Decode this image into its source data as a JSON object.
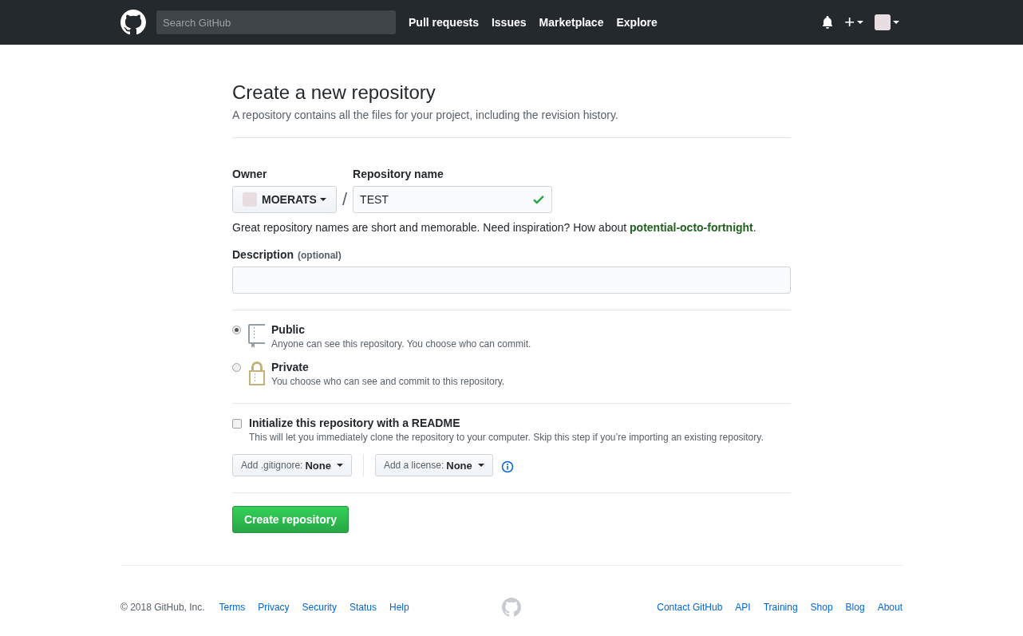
{
  "header": {
    "search": {
      "placeholder": "Search GitHub"
    },
    "nav": [
      "Pull requests",
      "Issues",
      "Marketplace",
      "Explore"
    ],
    "new_menu": "+"
  },
  "page": {
    "title": "Create a new repository",
    "subtitle": "A repository contains all the files for your project, including the revision history."
  },
  "owner": {
    "label": "Owner",
    "value": "MOERATS"
  },
  "separator": "/",
  "repository_name": {
    "label": "Repository name",
    "value": "TEST",
    "valid": true
  },
  "name_hint": {
    "text": "Great repository names are short and memorable. Need inspiration? How about ",
    "suggestion": "potential-octo-fortnight",
    "end": "."
  },
  "description": {
    "label": "Description",
    "note": "(optional)"
  },
  "visibility": [
    {
      "kind": "public",
      "title": "Public",
      "description": "Anyone can see this repository. You choose who can commit.",
      "selected": true
    },
    {
      "kind": "private",
      "title": "Private",
      "description": "You choose who can see and commit to this repository.",
      "selected": false
    }
  ],
  "readme": {
    "label": "Initialize this repository with a README",
    "description": "This will let you immediately clone the repository to your computer. Skip this step if you’re importing an existing repository.",
    "checked": false
  },
  "gitignore": {
    "label": "Add .gitignore:",
    "value": "None"
  },
  "license": {
    "label": "Add a license:",
    "value": "None"
  },
  "submit": "Create repository",
  "footer": {
    "copyright": "© 2018 GitHub, Inc.",
    "left_links": [
      "Terms",
      "Privacy",
      "Security",
      "Status",
      "Help"
    ],
    "right_links": [
      "Contact GitHub",
      "API",
      "Training",
      "Shop",
      "Blog",
      "About"
    ]
  }
}
